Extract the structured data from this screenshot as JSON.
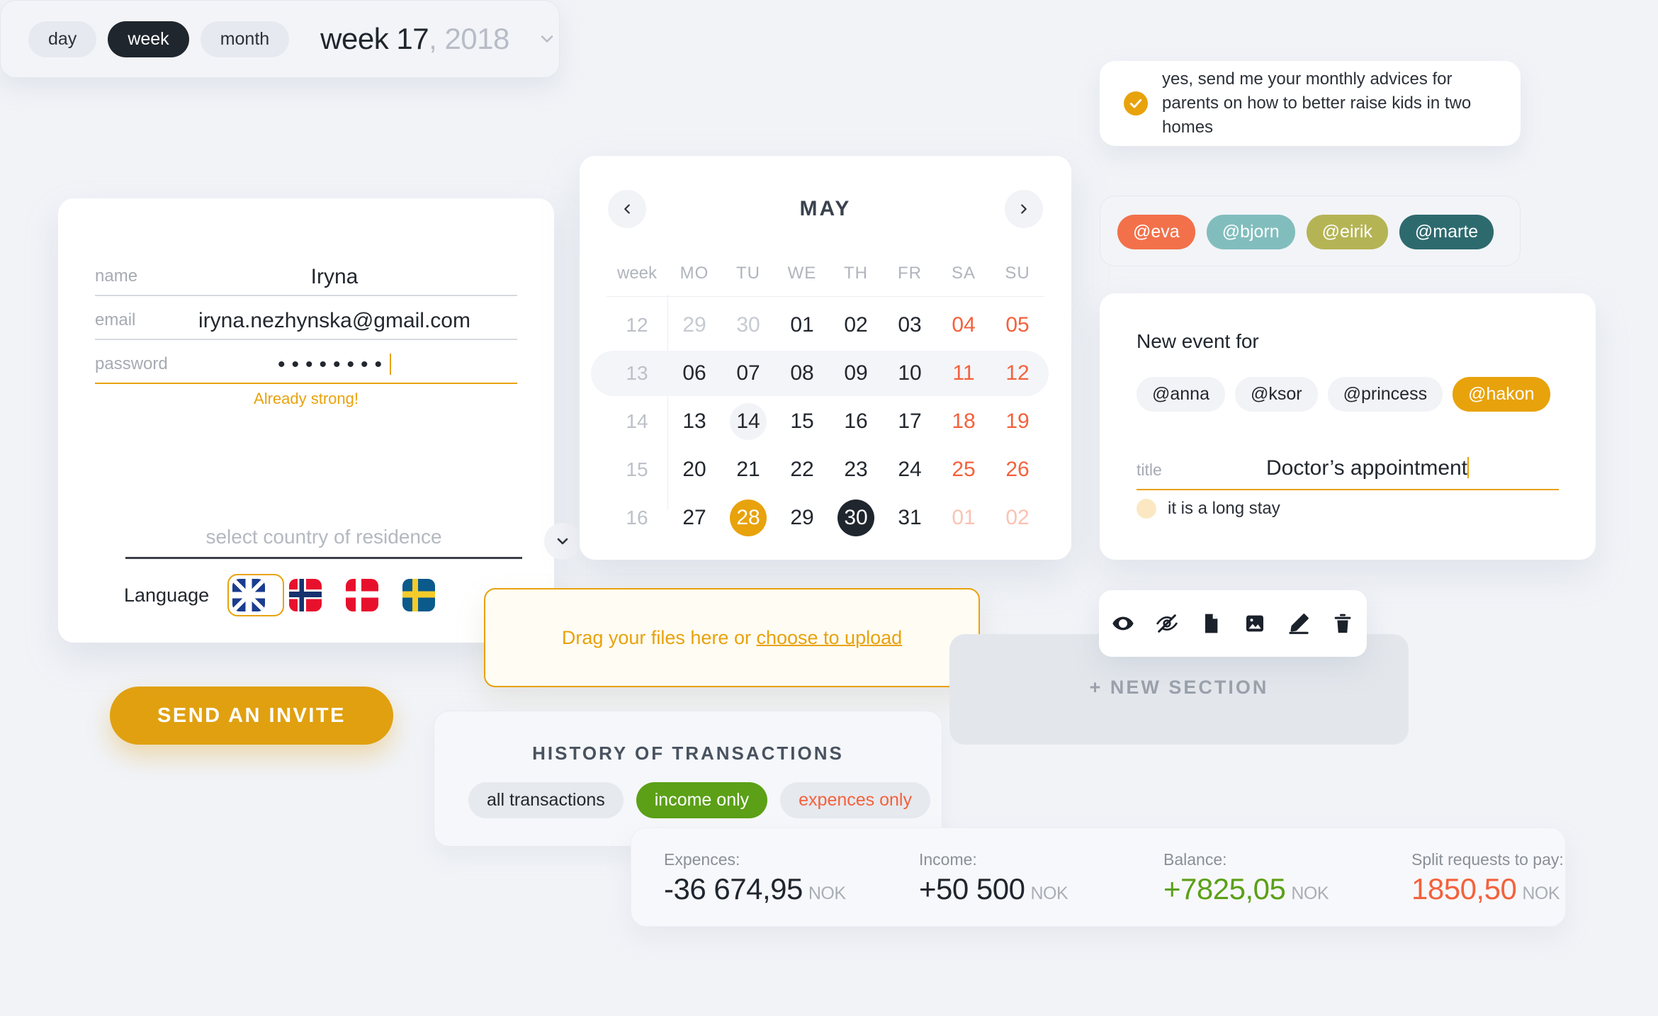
{
  "period_selector": {
    "options": [
      {
        "label": "day",
        "active": false
      },
      {
        "label": "week",
        "active": true
      },
      {
        "label": "month",
        "active": false
      }
    ],
    "current": "week 17",
    "year": "2018",
    "chevron_icon": "chevron-down-icon"
  },
  "profile": {
    "fields": [
      {
        "label": "name",
        "value": "Iryna"
      },
      {
        "label": "email",
        "value": "iryna.nezhynska@gmail.com"
      },
      {
        "label": "password",
        "value": "••••••••",
        "hint": "Already strong!"
      }
    ],
    "country": {
      "placeholder": "select country of residence",
      "value": "",
      "chevron_icon": "chevron-down-icon"
    },
    "language": {
      "label": "Language",
      "flags": [
        {
          "name": "united-kingdom",
          "selected": true
        },
        {
          "name": "norway",
          "selected": false
        },
        {
          "name": "denmark",
          "selected": false
        },
        {
          "name": "sweden",
          "selected": false
        }
      ]
    }
  },
  "send_invite_label": "SEND AN INVITE",
  "calendar": {
    "month": "MAY",
    "prev_icon": "chevron-left-icon",
    "next_icon": "chevron-right-icon",
    "headers": [
      "week",
      "MO",
      "TU",
      "WE",
      "TH",
      "FR",
      "SA",
      "SU"
    ],
    "weeks": [
      {
        "week": "12",
        "highlight": false,
        "days": [
          {
            "d": "29",
            "state": "mute"
          },
          {
            "d": "30",
            "state": "mute"
          },
          {
            "d": "01",
            "state": "normal"
          },
          {
            "d": "02",
            "state": "normal"
          },
          {
            "d": "03",
            "state": "normal"
          },
          {
            "d": "04",
            "state": "weekend"
          },
          {
            "d": "05",
            "state": "weekend"
          }
        ]
      },
      {
        "week": "13",
        "highlight": true,
        "days": [
          {
            "d": "06",
            "state": "normal"
          },
          {
            "d": "07",
            "state": "normal"
          },
          {
            "d": "08",
            "state": "normal"
          },
          {
            "d": "09",
            "state": "normal"
          },
          {
            "d": "10",
            "state": "normal"
          },
          {
            "d": "11",
            "state": "weekend"
          },
          {
            "d": "12",
            "state": "weekend"
          }
        ]
      },
      {
        "week": "14",
        "highlight": false,
        "days": [
          {
            "d": "13",
            "state": "normal"
          },
          {
            "d": "14",
            "state": "hover"
          },
          {
            "d": "15",
            "state": "normal"
          },
          {
            "d": "16",
            "state": "normal"
          },
          {
            "d": "17",
            "state": "normal"
          },
          {
            "d": "18",
            "state": "weekend"
          },
          {
            "d": "19",
            "state": "weekend"
          }
        ]
      },
      {
        "week": "15",
        "highlight": false,
        "days": [
          {
            "d": "20",
            "state": "normal"
          },
          {
            "d": "21",
            "state": "normal"
          },
          {
            "d": "22",
            "state": "normal"
          },
          {
            "d": "23",
            "state": "normal"
          },
          {
            "d": "24",
            "state": "normal"
          },
          {
            "d": "25",
            "state": "weekend"
          },
          {
            "d": "26",
            "state": "weekend"
          }
        ]
      },
      {
        "week": "16",
        "highlight": false,
        "days": [
          {
            "d": "27",
            "state": "normal"
          },
          {
            "d": "28",
            "state": "selected"
          },
          {
            "d": "29",
            "state": "normal"
          },
          {
            "d": "30",
            "state": "today"
          },
          {
            "d": "31",
            "state": "normal"
          },
          {
            "d": "01",
            "state": "weekend-mute"
          },
          {
            "d": "02",
            "state": "weekend-mute"
          }
        ]
      }
    ]
  },
  "dropzone": {
    "text": "Drag your files here or ",
    "link": "choose to upload"
  },
  "history": {
    "title": "HISTORY OF TRANSACTIONS",
    "filters": [
      {
        "label": "all transactions",
        "style": "default"
      },
      {
        "label": "income only",
        "style": "green"
      },
      {
        "label": "expences only",
        "style": "red"
      }
    ]
  },
  "totals": {
    "currency": "NOK",
    "items": [
      {
        "key": "Expences:",
        "value": "-36 674,95",
        "style": "dark"
      },
      {
        "key": "Income:",
        "value": "+50 500",
        "style": "dark"
      },
      {
        "key": "Balance:",
        "value": "+7825,05",
        "style": "green"
      },
      {
        "key": "Split requests to pay:",
        "value": "1850,50",
        "style": "red"
      }
    ]
  },
  "subscribe": {
    "checked": true,
    "check_icon": "check-circle-icon",
    "text": "yes, send me your monthly advices for parents on how to better raise kids in two homes"
  },
  "mentions": [
    {
      "label": "@eva",
      "color": "#f2714b"
    },
    {
      "label": "@bjorn",
      "color": "#82bdbd"
    },
    {
      "label": "@eirik",
      "color": "#b5b455"
    },
    {
      "label": "@marte",
      "color": "#2d6a6e"
    }
  ],
  "new_event": {
    "title": "New event for",
    "people": [
      {
        "label": "@anna",
        "selected": false
      },
      {
        "label": "@ksor",
        "selected": false
      },
      {
        "label": "@princess",
        "selected": false
      },
      {
        "label": "@hakon",
        "selected": true
      }
    ],
    "title_field": {
      "label": "title",
      "value": "Doctor’s appointment"
    },
    "note": "it is a long stay"
  },
  "new_section_label": "+ NEW SECTION",
  "toolbar_icons": [
    "eye-icon",
    "eye-off-icon",
    "file-icon",
    "image-icon",
    "pencil-icon",
    "trash-icon"
  ],
  "colors": {
    "accent": "#e8a20c",
    "dark": "#20262e",
    "green": "#5ba016",
    "red": "#f4613c",
    "background": "#f1f3f7"
  }
}
